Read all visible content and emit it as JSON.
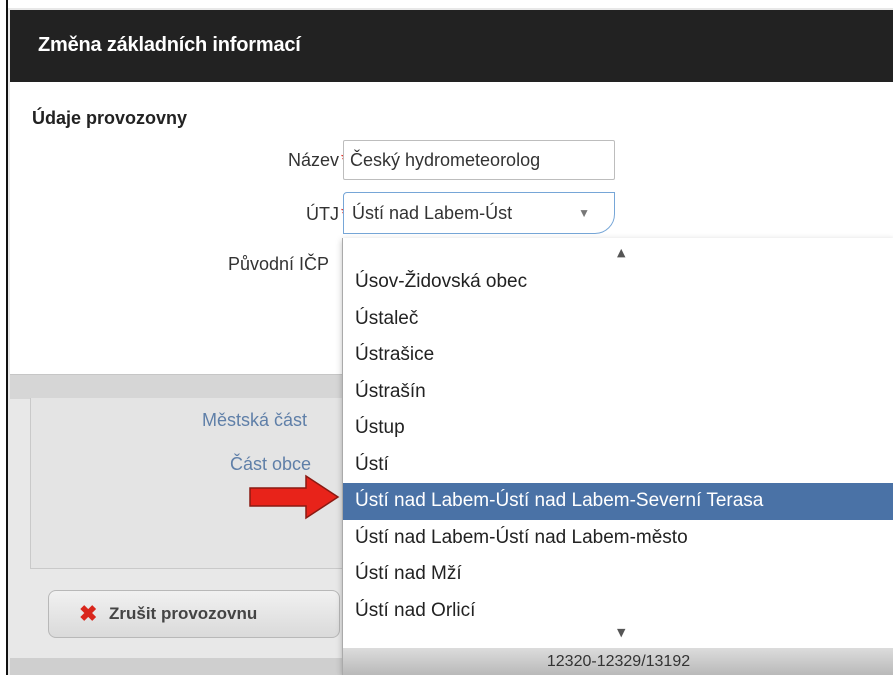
{
  "modal": {
    "title": "Změna základních informací"
  },
  "form": {
    "section_title": "Údaje provozovny",
    "name_label": "Název",
    "name_value": "Český hydrometeorolog",
    "utj_label": "ÚTJ",
    "utj_value": "Ústí nad Labem-Úst",
    "original_icp_label": "Původní IČP",
    "required_mark": "*"
  },
  "background": {
    "city_part_label": "Městská část",
    "town_part_label": "Část obce",
    "cancel_button_label": "Zrušit provozovnu"
  },
  "dropdown": {
    "items": [
      "Úsov-Židovská obec",
      "Ústaleč",
      "Ústrašice",
      "Ústrašín",
      "Ústup",
      "Ústí",
      "Ústí nad Labem-Ústí nad Labem-Severní Terasa",
      "Ústí nad Labem-Ústí nad Labem-město",
      "Ústí nad Mží",
      "Ústí nad Orlicí"
    ],
    "active_index": 6,
    "footer_text": "12320-12329/13192"
  },
  "colors": {
    "header_bg": "#222222",
    "active_item_bg": "#4a72a6",
    "required_color": "#d9261c",
    "annotation_arrow": "#e8231a"
  },
  "icons": {
    "cancel": "x-icon",
    "caret": "chevron-down-icon",
    "scroll_up": "chevron-up-icon",
    "scroll_down": "chevron-down-icon",
    "annotation": "red-arrow-icon"
  }
}
